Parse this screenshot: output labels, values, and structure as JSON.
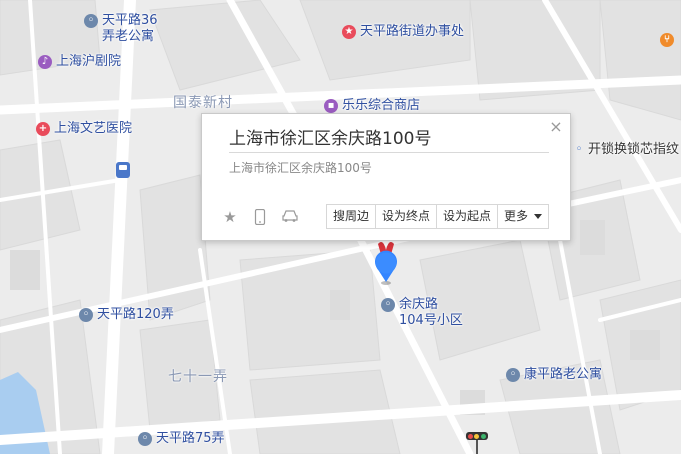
{
  "map": {
    "pois": [
      {
        "label": "天平路36",
        "label2": "弄老公寓",
        "kind": "gray"
      },
      {
        "label": "天平路街道办事处",
        "kind": "red"
      },
      {
        "label": "上海沪剧院",
        "kind": "purple"
      },
      {
        "label": "乐乐综合商店",
        "kind": "purple"
      },
      {
        "label": "上海文艺医院",
        "kind": "red"
      },
      {
        "label": "开锁换锁芯指纹",
        "kind": "blue"
      },
      {
        "label": "天平路120弄",
        "kind": "gray"
      },
      {
        "label": "余庆路",
        "label2": "104号小区",
        "kind": "gray"
      },
      {
        "label": "康平路老公寓",
        "kind": "gray"
      },
      {
        "label": "天平路75弄",
        "kind": "gray"
      }
    ],
    "areas": [
      {
        "label": "国泰新村"
      },
      {
        "label": "七十一弄"
      }
    ],
    "colors": {
      "marker": "#3385ff",
      "road": "#ffffff",
      "block": "#e6e6e6"
    }
  },
  "info_window": {
    "title": "上海市徐汇区余庆路100号",
    "address": "上海市徐汇区余庆路100号",
    "close_icon": "×",
    "actions": {
      "nearby": "搜周边",
      "set_end": "设为终点",
      "set_start": "设为起点",
      "more": "更多"
    }
  }
}
